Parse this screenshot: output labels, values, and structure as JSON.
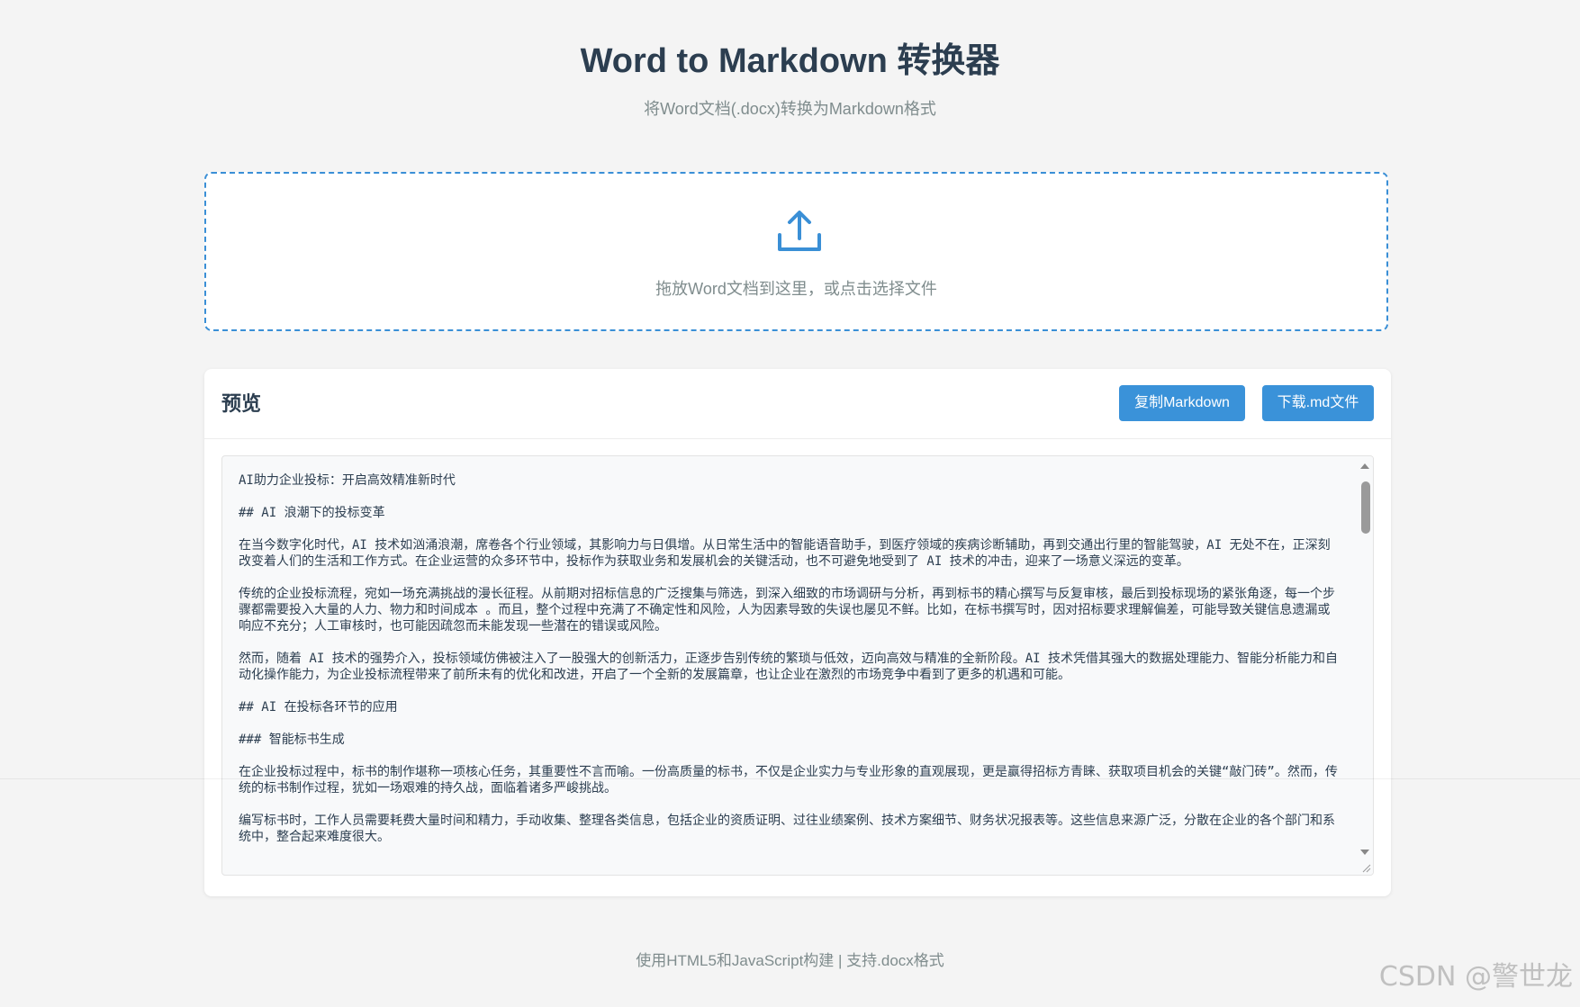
{
  "page": {
    "title": "Word to Markdown 转换器",
    "subtitle": "将Word文档(.docx)转换为Markdown格式"
  },
  "upload": {
    "hint": "拖放Word文档到这里，或点击选择文件",
    "icon": "upload-icon"
  },
  "preview": {
    "title": "预览",
    "copy_label": "复制Markdown",
    "download_label": "下载.md文件",
    "paragraphs": [
      "AI助力企业投标：开启高效精准新时代",
      "## AI 浪潮下的投标变革",
      "在当今数字化时代，AI 技术如汹涌浪潮，席卷各个行业领域，其影响力与日俱增。从日常生活中的智能语音助手，到医疗领域的疾病诊断辅助，再到交通出行里的智能驾驶，AI 无处不在，正深刻改变着人们的生活和工作方式。在企业运营的众多环节中，投标作为获取业务和发展机会的关键活动，也不可避免地受到了 AI 技术的冲击，迎来了一场意义深远的变革。",
      "传统的企业投标流程，宛如一场充满挑战的漫长征程。从前期对招标信息的广泛搜集与筛选，到深入细致的市场调研与分析，再到标书的精心撰写与反复审核，最后到投标现场的紧张角逐，每一个步骤都需要投入大量的人力、物力和时间成本 。而且，整个过程中充满了不确定性和风险，人为因素导致的失误也屡见不鲜。比如，在标书撰写时，因对招标要求理解偏差，可能导致关键信息遗漏或响应不充分；人工审核时，也可能因疏忽而未能发现一些潜在的错误或风险。",
      "然而，随着 AI 技术的强势介入，投标领域仿佛被注入了一股强大的创新活力，正逐步告别传统的繁琐与低效，迈向高效与精准的全新阶段。AI 技术凭借其强大的数据处理能力、智能分析能力和自动化操作能力，为企业投标流程带来了前所未有的优化和改进，开启了一个全新的发展篇章，也让企业在激烈的市场竞争中看到了更多的机遇和可能。",
      "## AI 在投标各环节的应用",
      "### 智能标书生成",
      "在企业投标过程中，标书的制作堪称一项核心任务，其重要性不言而喻。一份高质量的标书，不仅是企业实力与专业形象的直观展现，更是赢得招标方青睐、获取项目机会的关键“敲门砖”。然而，传统的标书制作过程，犹如一场艰难的持久战，面临着诸多严峻挑战。",
      "编写标书时，工作人员需要耗费大量时间和精力，手动收集、整理各类信息，包括企业的资质证明、过往业绩案例、技术方案细节、财务状况报表等。这些信息来源广泛，分散在企业的各个部门和系统中，整合起来难度很大。"
    ]
  },
  "footer": {
    "text": "使用HTML5和JavaScript构建 | 支持.docx格式"
  },
  "watermark": {
    "text": "CSDN @警世龙"
  },
  "colors": {
    "accent": "#3a92d9",
    "dashed_border": "#3a8fd6",
    "title": "#2c3e50",
    "muted": "#7f8c8d"
  }
}
